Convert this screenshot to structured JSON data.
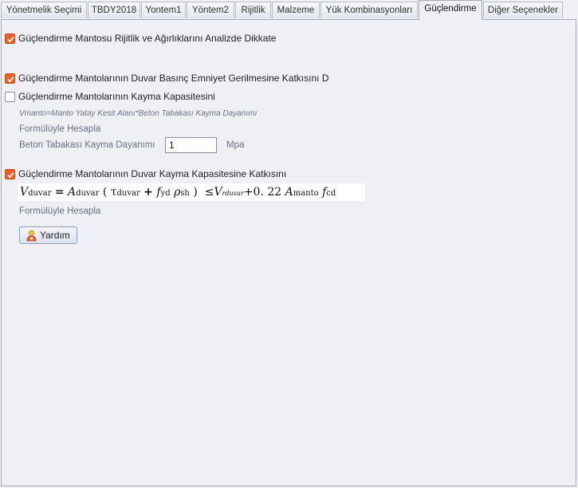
{
  "tabs": [
    {
      "label": "Yönetmelik Seçimi",
      "active": false
    },
    {
      "label": "TBDY2018",
      "active": false
    },
    {
      "label": "Yontem1",
      "active": false
    },
    {
      "label": "Yöntem2",
      "active": false
    },
    {
      "label": "Rijitlik",
      "active": false
    },
    {
      "label": "Malzeme",
      "active": false
    },
    {
      "label": "Yük Kombinasyonları",
      "active": false
    },
    {
      "label": "Güçlendirme",
      "active": true
    },
    {
      "label": "Diğer Seçenekler",
      "active": false
    }
  ],
  "options": {
    "opt1": {
      "label": "Güçlendirme Mantosu Rijitlik ve Ağırlıklarını Analizde Dikkate",
      "checked": true
    },
    "opt2": {
      "label": "Güçlendirme Mantolarının Duvar Basınç Emniyet Gerilmesine Katkısını D",
      "checked": true
    },
    "opt3": {
      "label": "Güçlendirme Mantolarının Kayma Kapasitesini",
      "checked": false
    },
    "opt4": {
      "label": "Güçlendirme Mantolarının Duvar Kayma Kapasitesine Katkısını",
      "checked": true
    }
  },
  "shear": {
    "note": "Vmanto=Manto Yatay Kesit Alanı*Beton Tabakası Kayma Dayanımı",
    "formula_text": "Formülüyle Hesapla",
    "field_label": "Beton Tabakası Kayma Dayanımı",
    "field_value": "1",
    "unit": "Mpa"
  },
  "formula": {
    "V": "V",
    "duvar_sub": "duvar",
    "eq": "=",
    "A": "A",
    "lparen": "(",
    "tau": "τ",
    "plus1": "+",
    "f": "f",
    "yd_sub": "yd",
    "rho": "ρ",
    "sh_sub": "sh",
    "rparen": ")",
    "le": "≤",
    "rduvar_sub": "rduvar",
    "plus2": "+",
    "coef": "0. 22",
    "manto_sub": "manto",
    "cd_sub": "cd"
  },
  "formula_note": "Formülüyle Hesapla",
  "help_button": "Yardım",
  "colors": {
    "checkbox_checked": "#e8602a",
    "background": "#eef0f5"
  }
}
